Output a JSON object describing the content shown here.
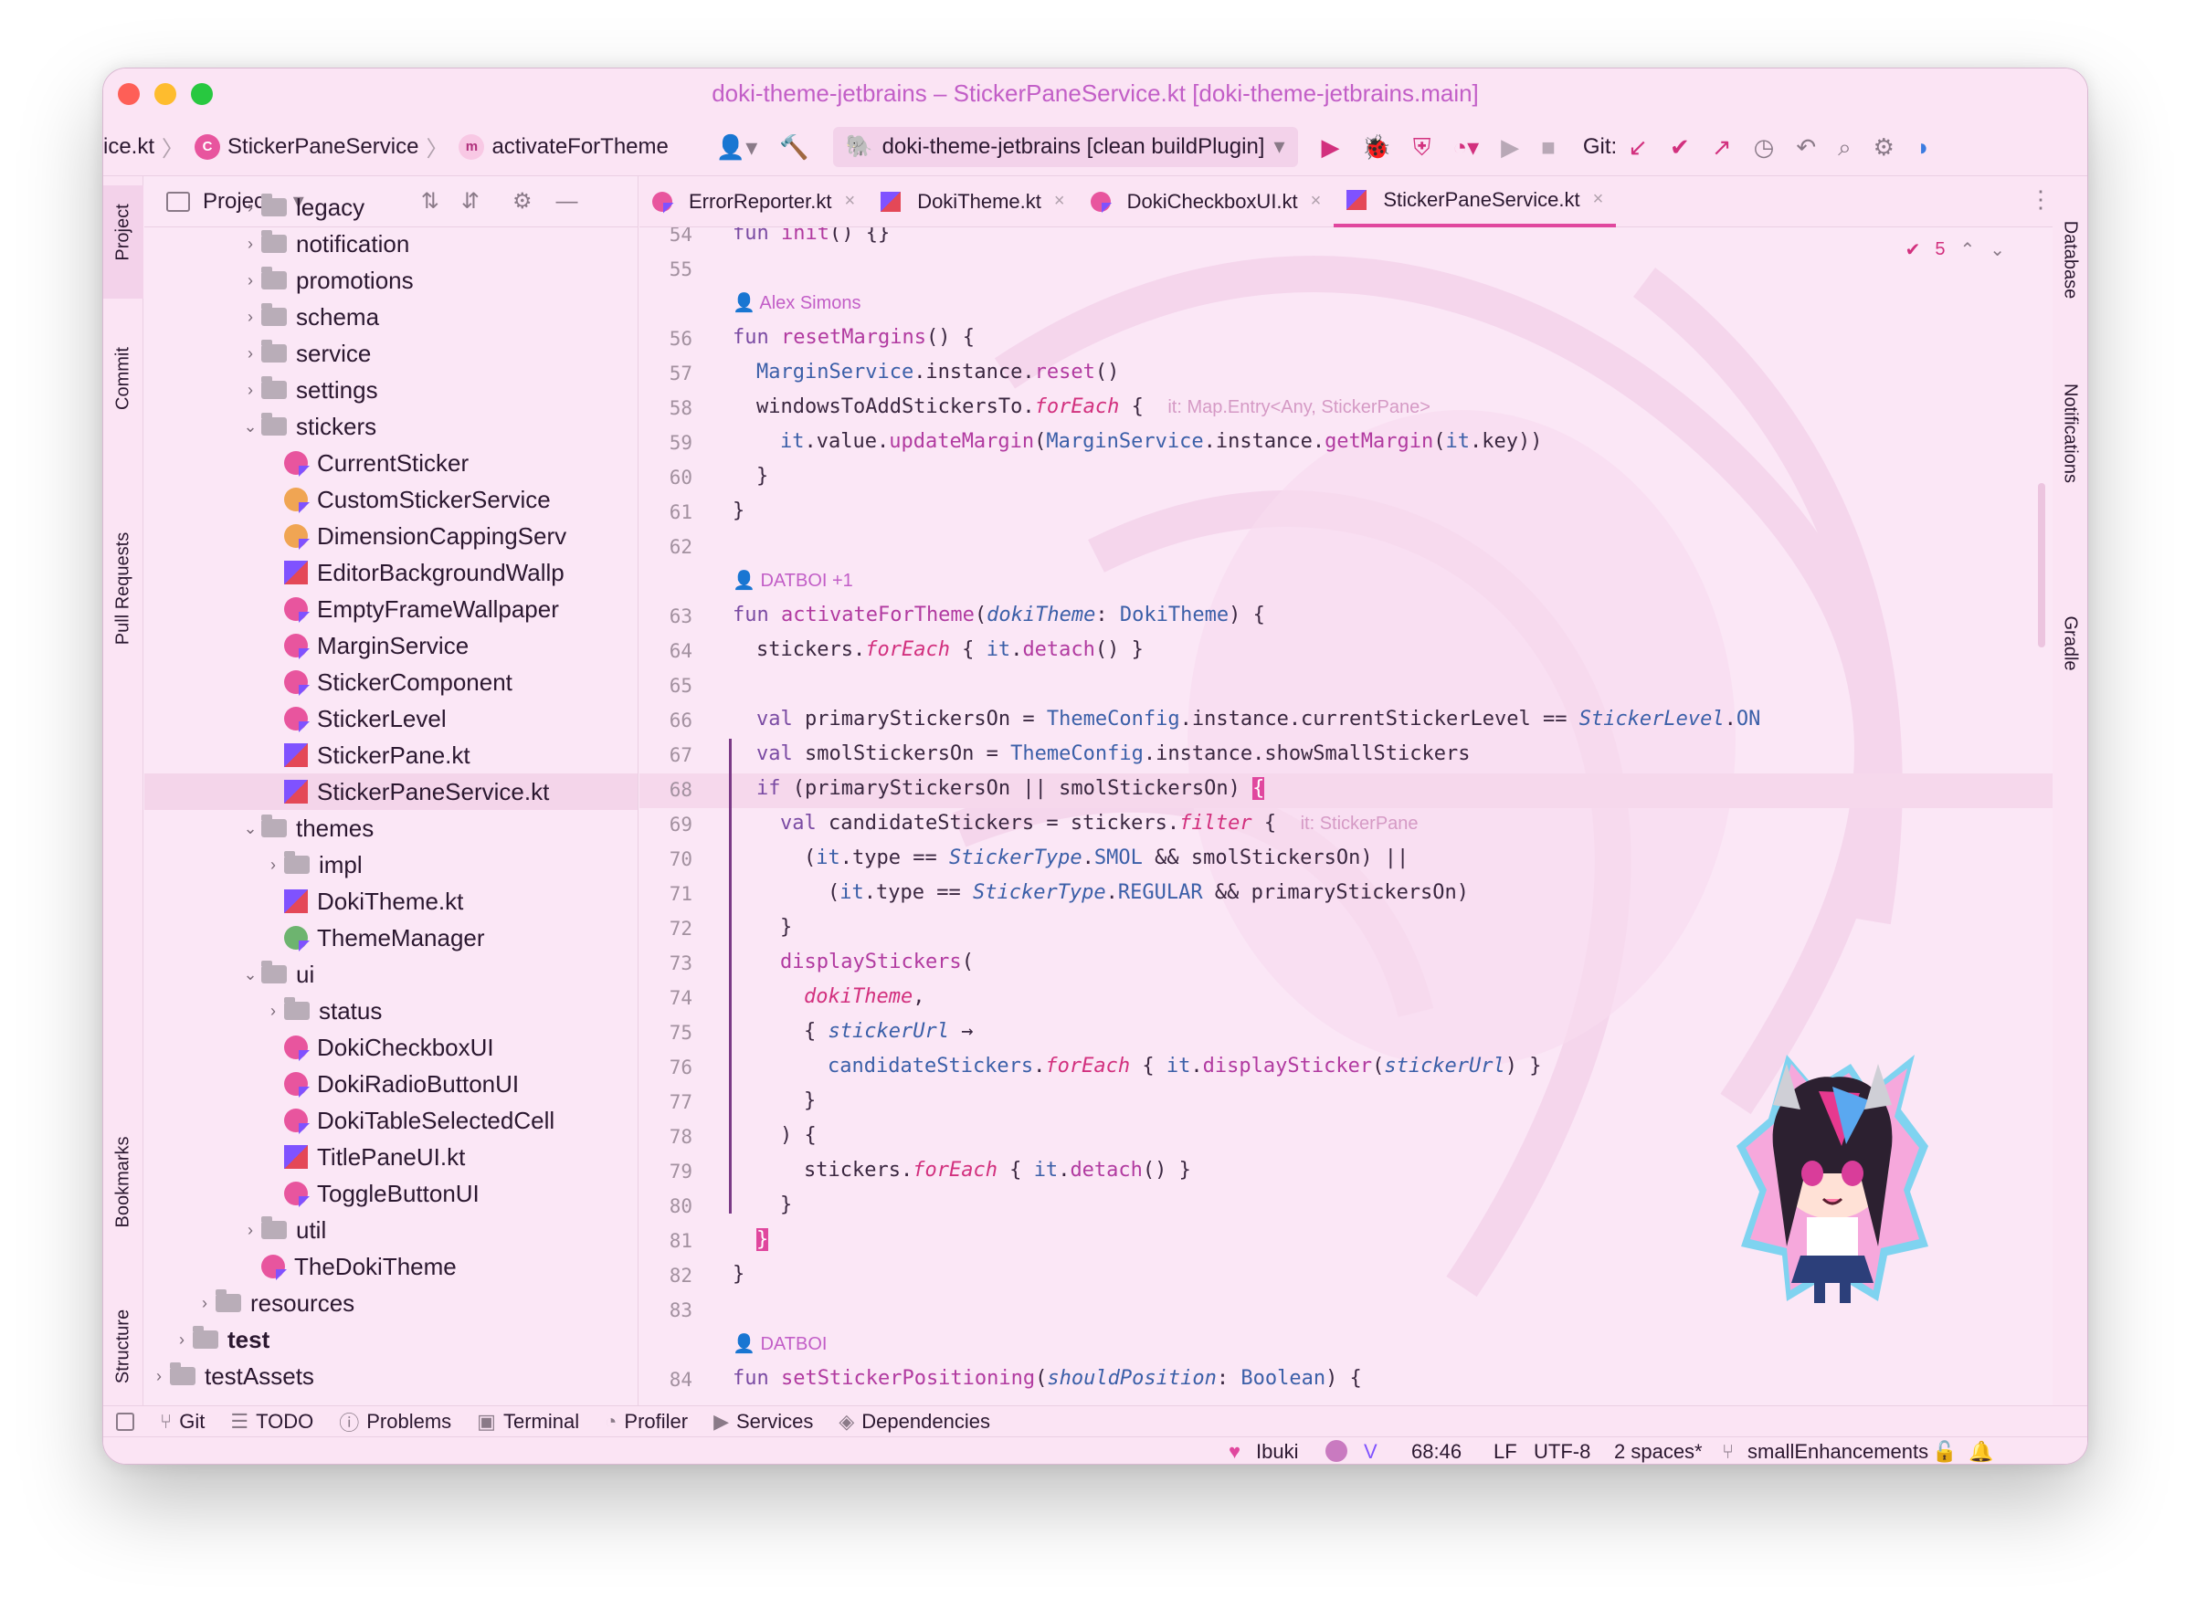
{
  "window": {
    "title": "doki-theme-jetbrains – StickerPaneService.kt [doki-theme-jetbrains.main]"
  },
  "toolbar": {
    "crumb_file": "ice.kt",
    "crumb_class": "StickerPaneService",
    "crumb_method": "activateForTheme",
    "run_config": "doki-theme-jetbrains [clean buildPlugin]",
    "git_label": "Git:"
  },
  "left_tabs": [
    "Project",
    "Commit",
    "Pull Requests",
    "Bookmarks",
    "Structure"
  ],
  "right_tabs": [
    "Database",
    "Notifications",
    "Gradle"
  ],
  "project": {
    "title": "Project",
    "tree": [
      {
        "label": "legacy",
        "kind": "folder",
        "depth": 4,
        "arrow": "›"
      },
      {
        "label": "notification",
        "kind": "folder",
        "depth": 4,
        "arrow": "›"
      },
      {
        "label": "promotions",
        "kind": "folder",
        "depth": 4,
        "arrow": "›"
      },
      {
        "label": "schema",
        "kind": "folder",
        "depth": 4,
        "arrow": "›"
      },
      {
        "label": "service",
        "kind": "folder",
        "depth": 4,
        "arrow": "›"
      },
      {
        "label": "settings",
        "kind": "folder",
        "depth": 4,
        "arrow": "›"
      },
      {
        "label": "stickers",
        "kind": "folder",
        "depth": 4,
        "arrow": "⌄"
      },
      {
        "label": "CurrentSticker",
        "kind": "class",
        "depth": 5,
        "arrow": ""
      },
      {
        "label": "CustomStickerService",
        "kind": "class-orange",
        "depth": 5,
        "arrow": ""
      },
      {
        "label": "DimensionCappingServ",
        "kind": "class-orange",
        "depth": 5,
        "arrow": ""
      },
      {
        "label": "EditorBackgroundWallp",
        "kind": "file",
        "depth": 5,
        "arrow": ""
      },
      {
        "label": "EmptyFrameWallpaper",
        "kind": "class",
        "depth": 5,
        "arrow": ""
      },
      {
        "label": "MarginService",
        "kind": "class",
        "depth": 5,
        "arrow": ""
      },
      {
        "label": "StickerComponent",
        "kind": "class",
        "depth": 5,
        "arrow": ""
      },
      {
        "label": "StickerLevel",
        "kind": "class",
        "depth": 5,
        "arrow": ""
      },
      {
        "label": "StickerPane.kt",
        "kind": "file",
        "depth": 5,
        "arrow": ""
      },
      {
        "label": "StickerPaneService.kt",
        "kind": "file",
        "depth": 5,
        "arrow": "",
        "selected": true
      },
      {
        "label": "themes",
        "kind": "folder",
        "depth": 4,
        "arrow": "⌄"
      },
      {
        "label": "impl",
        "kind": "folder",
        "depth": 5,
        "arrow": "›"
      },
      {
        "label": "DokiTheme.kt",
        "kind": "file",
        "depth": 5,
        "arrow": ""
      },
      {
        "label": "ThemeManager",
        "kind": "class-green",
        "depth": 5,
        "arrow": ""
      },
      {
        "label": "ui",
        "kind": "folder",
        "depth": 4,
        "arrow": "⌄"
      },
      {
        "label": "status",
        "kind": "folder",
        "depth": 5,
        "arrow": "›"
      },
      {
        "label": "DokiCheckboxUI",
        "kind": "class",
        "depth": 5,
        "arrow": ""
      },
      {
        "label": "DokiRadioButtonUI",
        "kind": "class",
        "depth": 5,
        "arrow": ""
      },
      {
        "label": "DokiTableSelectedCell",
        "kind": "class",
        "depth": 5,
        "arrow": ""
      },
      {
        "label": "TitlePaneUI.kt",
        "kind": "file",
        "depth": 5,
        "arrow": ""
      },
      {
        "label": "ToggleButtonUI",
        "kind": "class",
        "depth": 5,
        "arrow": ""
      },
      {
        "label": "util",
        "kind": "folder",
        "depth": 4,
        "arrow": "›"
      },
      {
        "label": "TheDokiTheme",
        "kind": "class",
        "depth": 4,
        "arrow": ""
      },
      {
        "label": "resources",
        "kind": "folder",
        "depth": 2,
        "arrow": "›"
      },
      {
        "label": "test",
        "kind": "folder",
        "depth": 1,
        "arrow": "›",
        "bold": true
      },
      {
        "label": "testAssets",
        "kind": "folder",
        "depth": 0,
        "arrow": "›"
      }
    ]
  },
  "tabs": [
    {
      "label": "ErrorReporter.kt",
      "icon": "class",
      "active": false
    },
    {
      "label": "DokiTheme.kt",
      "icon": "file",
      "active": false
    },
    {
      "label": "DokiCheckboxUI.kt",
      "icon": "class",
      "active": false
    },
    {
      "label": "StickerPaneService.kt",
      "icon": "file",
      "active": true
    }
  ],
  "editor": {
    "inspections_count": "5",
    "current_line": "68",
    "lines": [
      {
        "n": "54",
        "indent": 1,
        "html": "<span class=\"kw\">fun</span> <span class=\"fn\">init</span>() {}"
      },
      {
        "n": "55",
        "indent": 0,
        "html": ""
      },
      {
        "author": "Alex Simons"
      },
      {
        "n": "56",
        "indent": 1,
        "html": "<span class=\"kw\">fun</span> <span class=\"fn\">resetMargins</span>() {"
      },
      {
        "n": "57",
        "indent": 2,
        "html": "<span class=\"ty\">MarginService</span>.instance.<span class=\"fn\">reset</span>()"
      },
      {
        "n": "58",
        "indent": 2,
        "html": "windowsToAddStickersTo.<span class=\"ext\">forEach</span> {  <span class=\"hint\">it: Map.Entry&lt;Any, StickerPane&gt;</span>"
      },
      {
        "n": "59",
        "indent": 3,
        "html": "<span class=\"ty\">it</span>.value.<span class=\"fn\">updateMargin</span>(<span class=\"ty\">MarginService</span>.instance.<span class=\"fn\">getMargin</span>(<span class=\"ty\">it</span>.key))"
      },
      {
        "n": "60",
        "indent": 2,
        "html": "}"
      },
      {
        "n": "61",
        "indent": 1,
        "html": "}"
      },
      {
        "n": "62",
        "indent": 0,
        "html": ""
      },
      {
        "author": "DATBOI +1"
      },
      {
        "n": "63",
        "indent": 1,
        "html": "<span class=\"kw\">fun</span> <span class=\"fn\">activateForTheme</span>(<span class=\"it\">dokiTheme</span>: <span class=\"ty\">DokiTheme</span>) {"
      },
      {
        "n": "64",
        "indent": 2,
        "html": "stickers.<span class=\"ext\">forEach</span> { <span class=\"ty\">it</span>.<span class=\"fn\">detach</span>() }"
      },
      {
        "n": "65",
        "indent": 0,
        "html": ""
      },
      {
        "n": "66",
        "indent": 2,
        "html": "<span class=\"kw\">val</span> primaryStickersOn = <span class=\"ty\">ThemeConfig</span>.instance.currentStickerLevel == <span class=\"it\">StickerLevel</span>.<span class=\"ty\">ON</span>"
      },
      {
        "n": "67",
        "indent": 2,
        "html": "<span class=\"kw\">val</span> smolStickersOn = <span class=\"ty\">ThemeConfig</span>.instance.showSmallStickers"
      },
      {
        "n": "68",
        "indent": 2,
        "html": "<span class=\"kw\">if</span> (primaryStickersOn || smolStickersOn) <span style=\"background:#e0479e;color:#fff\">{</span>"
      },
      {
        "n": "69",
        "indent": 3,
        "html": "<span class=\"kw\">val</span> candidateStickers = stickers.<span class=\"ext\">filter</span> {  <span class=\"hint\">it: StickerPane</span>"
      },
      {
        "n": "70",
        "indent": 4,
        "html": "(<span class=\"ty\">it</span>.type == <span class=\"it\">StickerType</span>.<span class=\"ty\">SMOL</span> &amp;&amp; smolStickersOn) ||"
      },
      {
        "n": "71",
        "indent": 5,
        "html": "(<span class=\"ty\">it</span>.type == <span class=\"it\">StickerType</span>.<span class=\"ty\">REGULAR</span> &amp;&amp; primaryStickersOn)"
      },
      {
        "n": "72",
        "indent": 3,
        "html": "}"
      },
      {
        "n": "73",
        "indent": 3,
        "html": "<span class=\"fn\">displayStickers</span>("
      },
      {
        "n": "74",
        "indent": 4,
        "html": "<span class=\"ext\">dokiTheme</span>,"
      },
      {
        "n": "75",
        "indent": 4,
        "html": "{ <span class=\"it\">stickerUrl</span> →"
      },
      {
        "n": "76",
        "indent": 5,
        "html": "<span class=\"ty\">candidateStickers</span>.<span class=\"ext\">forEach</span> { <span class=\"ty\">it</span>.<span class=\"fn\">displaySticker</span>(<span class=\"it\">stickerUrl</span>) }"
      },
      {
        "n": "77",
        "indent": 4,
        "html": "}"
      },
      {
        "n": "78",
        "indent": 3,
        "html": ") {"
      },
      {
        "n": "79",
        "indent": 4,
        "html": "stickers.<span class=\"ext\">forEach</span> { <span class=\"ty\">it</span>.<span class=\"fn\">detach</span>() }"
      },
      {
        "n": "80",
        "indent": 3,
        "html": "}"
      },
      {
        "n": "81",
        "indent": 2,
        "html": "<span style=\"background:#e0479e;color:#fff\">}</span>"
      },
      {
        "n": "82",
        "indent": 1,
        "html": "}"
      },
      {
        "n": "83",
        "indent": 0,
        "html": ""
      },
      {
        "author": "DATBOI"
      },
      {
        "n": "84",
        "indent": 1,
        "html": "<span class=\"kw\">fun</span> <span class=\"fn\">setStickerPositioning</span>(<span class=\"it\">shouldPosition</span>: <span class=\"ty\">Boolean</span>) {"
      }
    ]
  },
  "bottom_tools": [
    {
      "label": "Git",
      "icon": "⑂"
    },
    {
      "label": "TODO",
      "icon": "☰"
    },
    {
      "label": "Problems",
      "icon": "ⓘ"
    },
    {
      "label": "Terminal",
      "icon": "▣"
    },
    {
      "label": "Profiler",
      "icon": "◔"
    },
    {
      "label": "Services",
      "icon": "▶"
    },
    {
      "label": "Dependencies",
      "icon": "◈"
    }
  ],
  "status": {
    "theme": "Ibuki",
    "position": "68:46",
    "line_sep": "LF",
    "encoding": "UTF-8",
    "indent": "2 spaces*",
    "branch": "smallEnhancements"
  }
}
